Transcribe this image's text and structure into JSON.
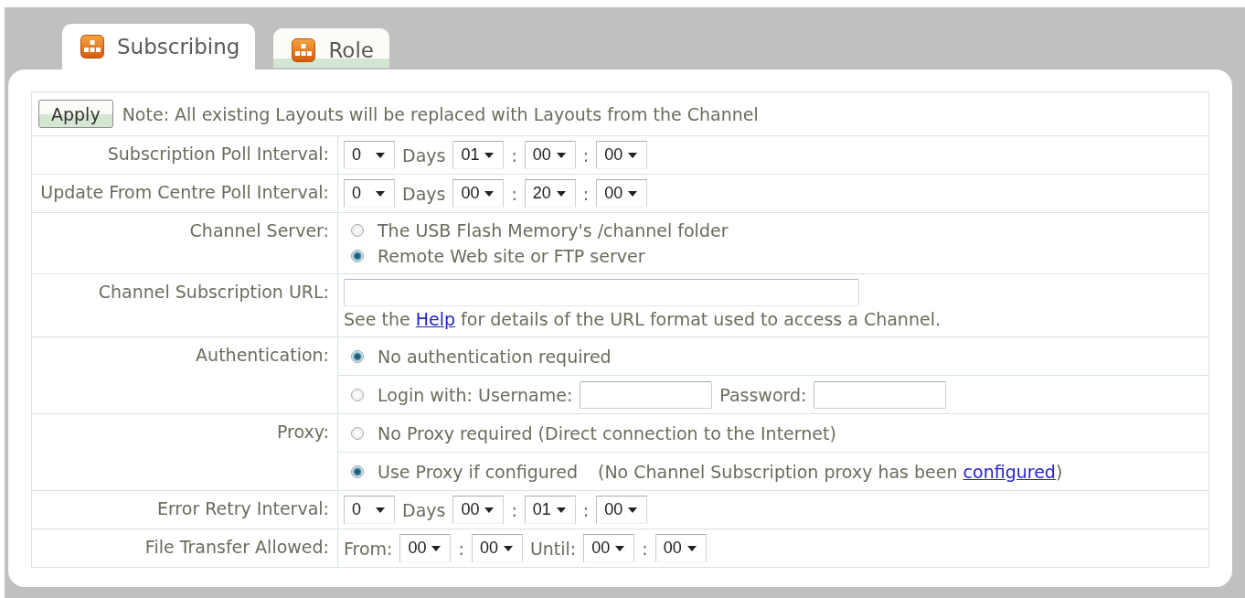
{
  "tabs": [
    {
      "label": "Subscribing",
      "selected": true
    },
    {
      "label": "Role",
      "selected": false
    }
  ],
  "apply_bar": {
    "button": "Apply",
    "note": "Note: All existing Layouts will be replaced with Layouts from the Channel"
  },
  "rows": [
    {
      "kind": "stacked",
      "label": "Subscription Poll Interval:",
      "lines": [
        {
          "items": [
            {
              "kind": "dropdown",
              "value": "0"
            },
            {
              "kind": "text",
              "text": "Days"
            },
            {
              "kind": "dropdown",
              "value": "01"
            },
            {
              "kind": "text",
              "text": ":"
            },
            {
              "kind": "dropdown",
              "value": "00"
            },
            {
              "kind": "text",
              "text": ":"
            },
            {
              "kind": "dropdown",
              "value": "00"
            }
          ]
        }
      ]
    },
    {
      "kind": "stacked",
      "label": "Update From Centre Poll Interval:",
      "lines": [
        {
          "items": [
            {
              "kind": "dropdown",
              "value": "0"
            },
            {
              "kind": "text",
              "text": "Days"
            },
            {
              "kind": "dropdown",
              "value": "00"
            },
            {
              "kind": "text",
              "text": ":"
            },
            {
              "kind": "dropdown",
              "value": "20"
            },
            {
              "kind": "text",
              "text": ":"
            },
            {
              "kind": "dropdown",
              "value": "00"
            }
          ]
        }
      ]
    },
    {
      "kind": "stacked",
      "label": "Channel Server:",
      "lines": [
        {
          "items": [
            {
              "kind": "radio",
              "label": "The USB Flash Memory's /channel folder",
              "selected": false
            }
          ]
        },
        {
          "items": [
            {
              "kind": "radio",
              "label": "Remote Web site or FTP server",
              "selected": true
            }
          ]
        }
      ]
    },
    {
      "kind": "stacked",
      "label": "Channel Subscription URL:",
      "lines": [
        {
          "items": [
            {
              "kind": "wide_input"
            }
          ]
        },
        {
          "items": [
            {
              "kind": "linked_text",
              "before": "See the ",
              "link": "Help",
              "after": " for details of the URL format used to access a Channel."
            }
          ]
        }
      ]
    },
    {
      "kind": "split",
      "label": "Authentication:",
      "lines": [
        {
          "items": [
            {
              "kind": "radio",
              "label": "No authentication required",
              "selected": true
            }
          ]
        },
        {
          "items": [
            {
              "kind": "radio",
              "label": "Login with: Username:",
              "selected": false
            },
            {
              "kind": "input"
            },
            {
              "kind": "text",
              "text": "Password:"
            },
            {
              "kind": "input"
            }
          ]
        }
      ]
    },
    {
      "kind": "split",
      "label": "Proxy:",
      "lines": [
        {
          "items": [
            {
              "kind": "radio",
              "label": "No Proxy required (Direct connection to the Internet)",
              "selected": false
            }
          ]
        },
        {
          "items": [
            {
              "kind": "radio",
              "label": "Use Proxy if configured",
              "selected": true
            },
            {
              "kind": "linked_text",
              "before": "(No Channel Subscription proxy has been ",
              "link": "configured",
              "after": ")"
            }
          ]
        }
      ]
    },
    {
      "kind": "stacked",
      "label": "Error Retry Interval:",
      "lines": [
        {
          "items": [
            {
              "kind": "dropdown",
              "value": "0"
            },
            {
              "kind": "text",
              "text": "Days"
            },
            {
              "kind": "dropdown",
              "value": "00"
            },
            {
              "kind": "text",
              "text": ":"
            },
            {
              "kind": "dropdown",
              "value": "01"
            },
            {
              "kind": "text",
              "text": ":"
            },
            {
              "kind": "dropdown",
              "value": "00"
            }
          ]
        }
      ]
    },
    {
      "kind": "stacked",
      "label": "File Transfer Allowed:",
      "lines": [
        {
          "items": [
            {
              "kind": "text",
              "text": "From:"
            },
            {
              "kind": "dropdown",
              "value": "00"
            },
            {
              "kind": "text",
              "text": ":"
            },
            {
              "kind": "dropdown",
              "value": "00"
            },
            {
              "kind": "text",
              "text": "Until:"
            },
            {
              "kind": "dropdown",
              "value": "00"
            },
            {
              "kind": "text",
              "text": ":"
            },
            {
              "kind": "dropdown",
              "value": "00"
            }
          ]
        }
      ]
    }
  ]
}
